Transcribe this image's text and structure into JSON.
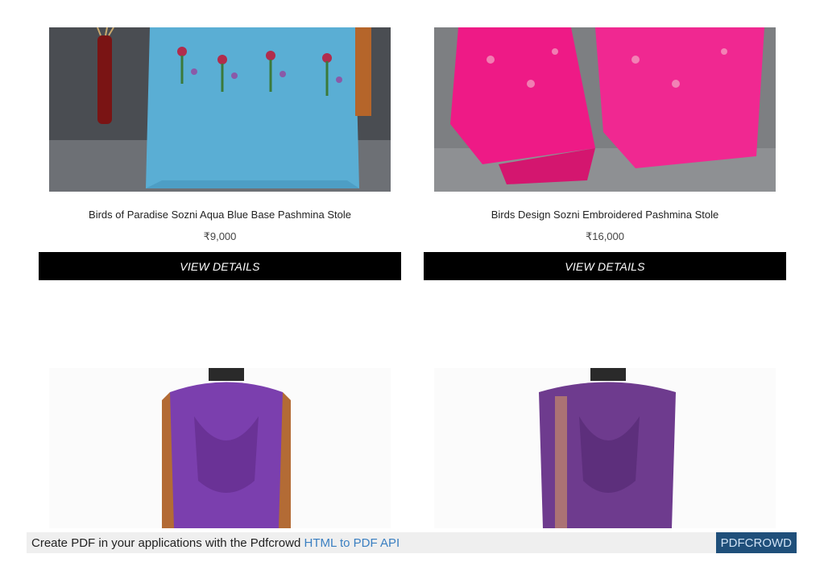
{
  "products": [
    {
      "title": "Birds of Paradise Sozni Aqua Blue Base Pashmina Stole",
      "price": "₹9,000",
      "button_label": "VIEW DETAILS"
    },
    {
      "title": "Birds Design Sozni Embroidered Pashmina Stole",
      "price": "₹16,000",
      "button_label": "VIEW DETAILS"
    }
  ],
  "pdf_banner": {
    "text": "Create PDF in your applications with the Pdfcrowd",
    "link_label": "HTML to PDF API",
    "brand_label": "PDFCROWD"
  },
  "colors": {
    "button_bg": "#000000",
    "link": "#3a7fc1",
    "brand_bg": "#1f4f7a"
  }
}
